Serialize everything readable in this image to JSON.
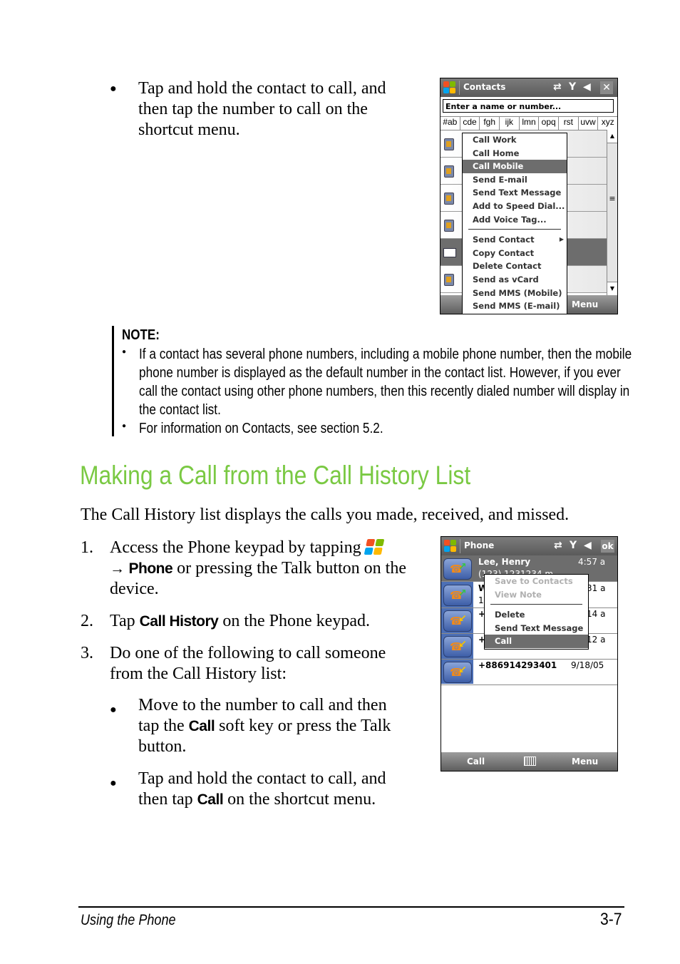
{
  "top_bullet": "Tap and hold the contact to call, and then tap the number to call on the shortcut menu.",
  "contacts_screen": {
    "title": "Contacts",
    "search_placeholder": "Enter a name or number...",
    "alpha_tabs": [
      "#ab",
      "cde",
      "fgh",
      "ijk",
      "lmn",
      "opq",
      "rst",
      "uvw",
      "xyz"
    ],
    "menu_items": [
      {
        "label": "Call Work",
        "state": "normal"
      },
      {
        "label": "Call Home",
        "state": "normal"
      },
      {
        "label": "Call Mobile",
        "state": "selected"
      },
      {
        "label": "Send E-mail",
        "state": "normal"
      },
      {
        "label": "Send Text Message",
        "state": "normal"
      },
      {
        "label": "Add to Speed Dial...",
        "state": "normal"
      },
      {
        "label": "Add Voice Tag...",
        "state": "normal"
      },
      {
        "label": "Send Contact",
        "state": "normal",
        "submenu": true,
        "separator_before": true
      },
      {
        "label": "Copy Contact",
        "state": "normal"
      },
      {
        "label": "Delete Contact",
        "state": "normal"
      },
      {
        "label": "Send as vCard",
        "state": "normal"
      },
      {
        "label": "Send MMS (Mobile)",
        "state": "normal"
      },
      {
        "label": "Send MMS (E-mail)",
        "state": "normal"
      }
    ],
    "softkey_right": "Menu",
    "submenu_arrow": "▶",
    "scroll_up": "▲",
    "scroll_down": "▼",
    "scroll_grip": "≡"
  },
  "note": {
    "heading": "NOTE:",
    "bullets": [
      "If a contact has several phone numbers, including a mobile phone number, then the mobile phone number is displayed as the default number in the contact list. However, if you ever call the contact using other phone numbers, then this recently dialed number will display in the contact list.",
      "For information on Contacts, see section 5.2."
    ]
  },
  "section": {
    "title": "Making a Call from the Call History List",
    "title_color": "#7ac943",
    "intro": "The Call History list displays the calls you made, received, and missed."
  },
  "steps": [
    {
      "num": "1.",
      "pre": "Access the Phone keypad by tapping",
      "arrow": "→",
      "bold": "Phone",
      "post": "or pressing the Talk button on the device."
    },
    {
      "num": "2.",
      "pre": "Tap",
      "bold": "Call History",
      "post": "on the Phone keypad."
    },
    {
      "num": "3.",
      "text": "Do one of the following to call someone from the Call History list:"
    }
  ],
  "sub_bullets": [
    {
      "pre": "Move to the number to call and then tap the",
      "bold": "Call",
      "post": "soft key or press the Talk button."
    },
    {
      "pre": "Tap and hold the contact to call, and then tap",
      "bold": "Call",
      "post": "on the shortcut menu."
    }
  ],
  "phone_screen": {
    "title": "Phone",
    "ok_label": "ok",
    "rows": [
      {
        "name": "Lee, Henry",
        "sub": "(123) 1231234 m",
        "time": "4:57 a",
        "type": "outgoing",
        "selected": true
      },
      {
        "name": "W",
        "sub": "1",
        "time": "31 a",
        "type": "outgoing"
      },
      {
        "name": "+",
        "sub": "",
        "time": "14 a",
        "type": "incoming"
      },
      {
        "name": "+",
        "sub": "",
        "time": "12 a",
        "type": "incoming"
      },
      {
        "name": "+886914293401",
        "sub": "",
        "time": "9/18/05",
        "type": "incoming"
      }
    ],
    "menu_items": [
      {
        "label": "Save to Contacts",
        "state": "disabled"
      },
      {
        "label": "View Note",
        "state": "disabled"
      },
      {
        "label": "Delete",
        "state": "normal",
        "separator_before": true
      },
      {
        "label": "Send Text Message",
        "state": "normal"
      },
      {
        "label": "Call",
        "state": "selected"
      }
    ],
    "softkey_left": "Call",
    "softkey_right": "Menu"
  },
  "footer": {
    "left": "Using the Phone",
    "page": "3-7"
  }
}
